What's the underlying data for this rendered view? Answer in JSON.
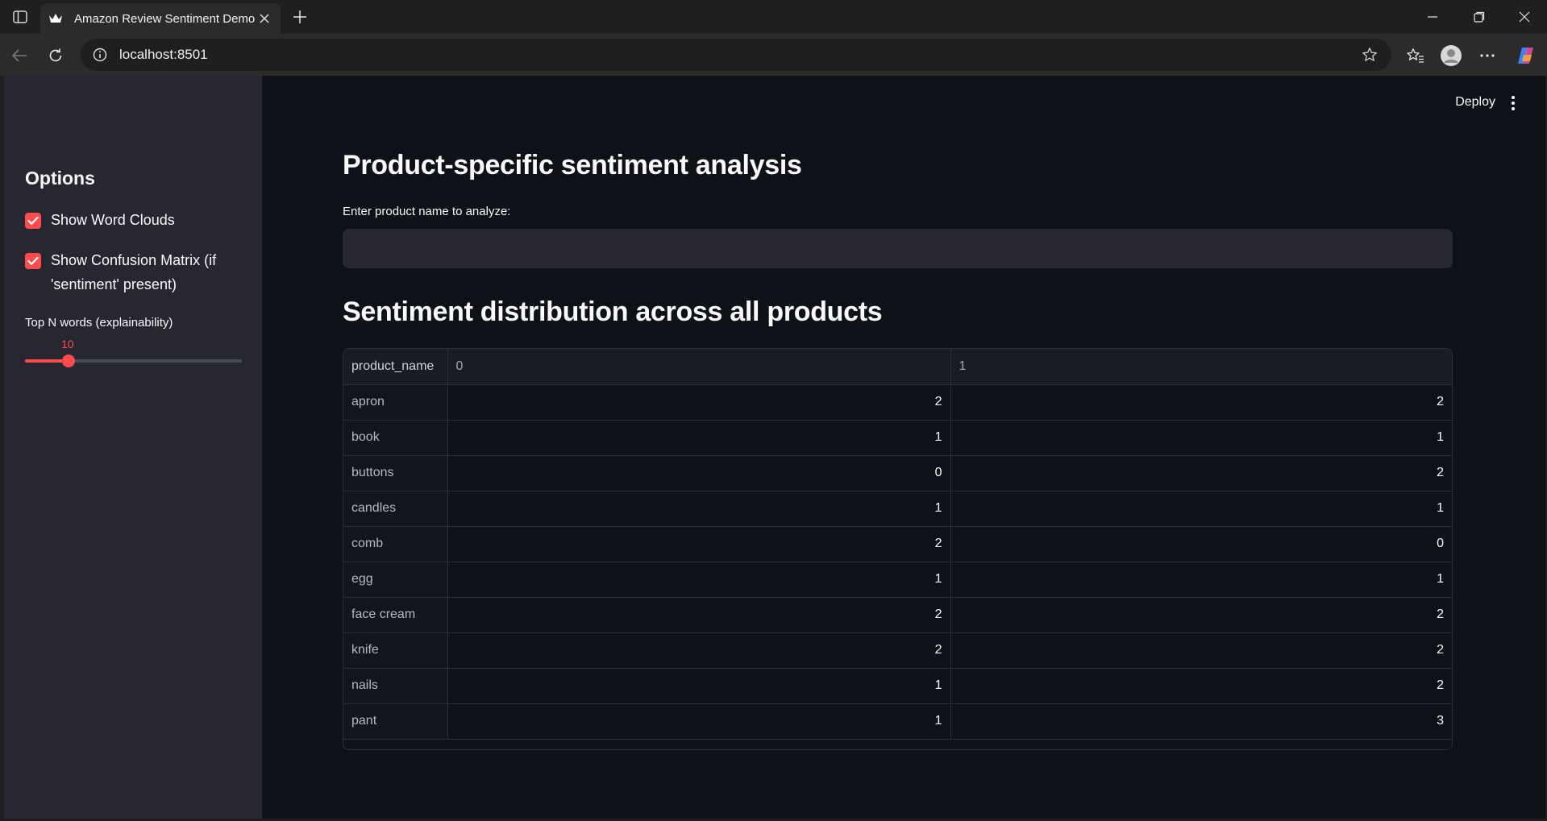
{
  "browser": {
    "tab_title": "Amazon Review Sentiment Demo",
    "url": "localhost:8501"
  },
  "sidebar": {
    "heading": "Options",
    "checkboxes": [
      {
        "label": "Show Word Clouds",
        "checked": true
      },
      {
        "label": "Show Confusion Matrix (if 'sentiment' present)",
        "checked": true
      }
    ],
    "slider": {
      "label": "Top N words (explainability)",
      "value": "10",
      "fraction": 0.2
    }
  },
  "main": {
    "deploy_label": "Deploy",
    "section1_title": "Product-specific sentiment analysis",
    "input_label": "Enter product name to analyze:",
    "input_value": "",
    "section2_title": "Sentiment distribution across all products",
    "table": {
      "columns": [
        "product_name",
        "0",
        "1"
      ],
      "rows": [
        [
          "apron",
          "2",
          "2"
        ],
        [
          "book",
          "1",
          "1"
        ],
        [
          "buttons",
          "0",
          "2"
        ],
        [
          "candles",
          "1",
          "1"
        ],
        [
          "comb",
          "2",
          "0"
        ],
        [
          "egg",
          "1",
          "1"
        ],
        [
          "face cream",
          "2",
          "2"
        ],
        [
          "knife",
          "2",
          "2"
        ],
        [
          "nails",
          "1",
          "2"
        ],
        [
          "pant",
          "1",
          "3"
        ]
      ]
    }
  },
  "colors": {
    "accent": "#ff4b4b",
    "app_background": "#0e1117",
    "sidebar_background": "#262730"
  }
}
